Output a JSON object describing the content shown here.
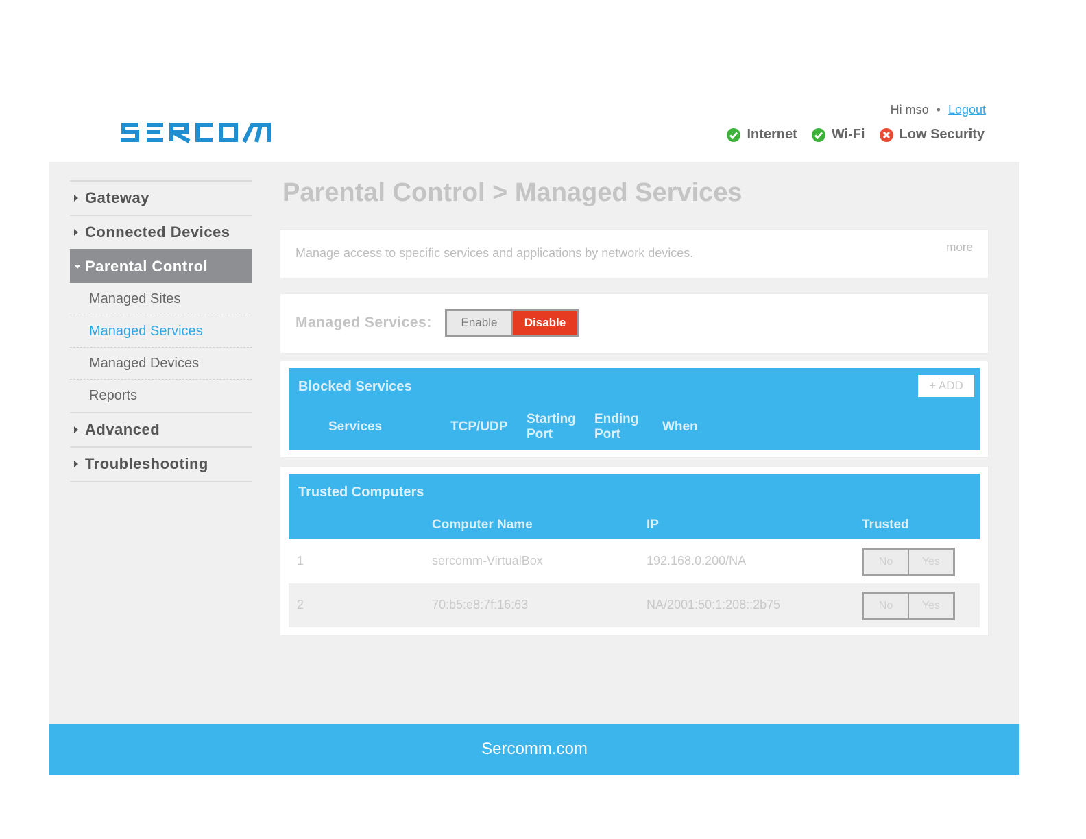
{
  "brand": {
    "logo_text": "SERCOMM",
    "accent": "#3bb5ec",
    "logo_color": "#1f8fd1"
  },
  "header": {
    "greeting": "Hi mso",
    "separator": "•",
    "logout_label": "Logout",
    "status": [
      {
        "label": "Internet",
        "state": "ok",
        "icon": "check-circle-icon",
        "color": "#3db33a"
      },
      {
        "label": "Wi-Fi",
        "state": "ok",
        "icon": "check-circle-icon",
        "color": "#3db33a"
      },
      {
        "label": "Low Security",
        "state": "warn",
        "icon": "x-circle-icon",
        "color": "#e84a33"
      }
    ]
  },
  "sidebar": {
    "items": [
      {
        "label": "Gateway"
      },
      {
        "label": "Connected Devices"
      },
      {
        "label": "Parental Control",
        "active": true
      },
      {
        "label": "Advanced"
      },
      {
        "label": "Troubleshooting"
      }
    ],
    "subitems": [
      {
        "label": "Managed Sites"
      },
      {
        "label": "Managed Services",
        "current": true
      },
      {
        "label": "Managed Devices"
      },
      {
        "label": "Reports"
      }
    ]
  },
  "main": {
    "title": "Parental Control > Managed Services",
    "description": "Manage access to specific services and applications by network devices.",
    "more_label": "more",
    "toggle": {
      "label": "Managed Services:",
      "enable_label": "Enable",
      "disable_label": "Disable",
      "selected": "Disable"
    },
    "blocked": {
      "title": "Blocked Services",
      "add_label": "+ ADD",
      "columns": [
        "Services",
        "TCP/UDP",
        "Starting Port",
        "Ending Port",
        "When"
      ]
    },
    "trusted": {
      "title": "Trusted Computers",
      "columns": [
        "Computer Name",
        "IP",
        "Trusted"
      ],
      "rows": [
        {
          "index": "1",
          "name": "sercomm-VirtualBox",
          "ip": "192.168.0.200/NA",
          "no": "No",
          "yes": "Yes"
        },
        {
          "index": "2",
          "name": "70:b5:e8:7f:16:63",
          "ip": "NA/2001:50:1:208::2b75",
          "no": "No",
          "yes": "Yes"
        }
      ]
    }
  },
  "footer": {
    "text": "Sercomm.com"
  }
}
